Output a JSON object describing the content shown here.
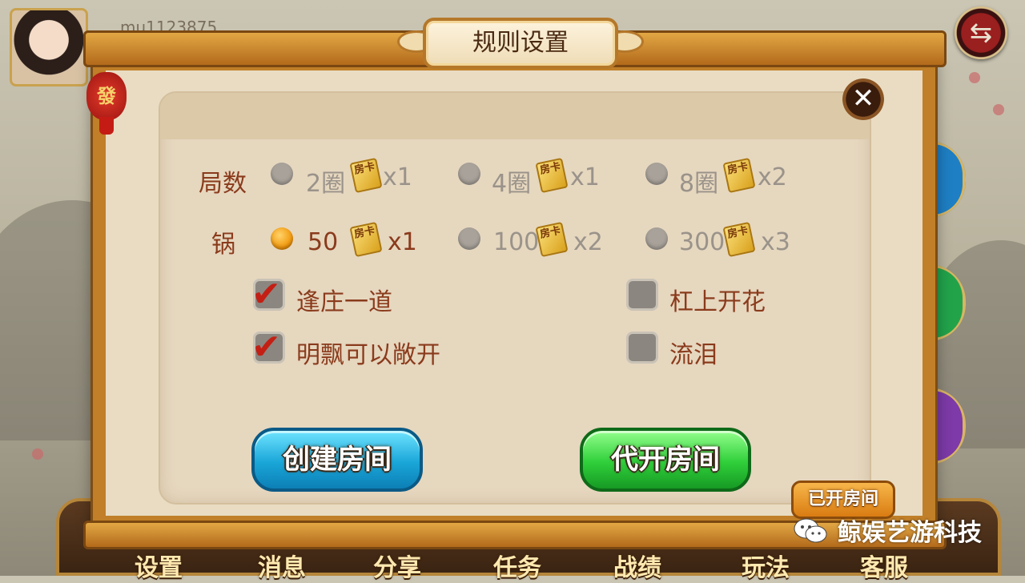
{
  "player": {
    "id": "mu1123875"
  },
  "dialog": {
    "title": "规则设置",
    "lantern_char": "發",
    "close_symbol": "✕"
  },
  "rules": {
    "rounds": {
      "label": "局数",
      "options": [
        {
          "text": "2圈",
          "multiplier": "x1",
          "selected": false
        },
        {
          "text": "4圈",
          "multiplier": "x1",
          "selected": false
        },
        {
          "text": "8圈",
          "multiplier": "x2",
          "selected": false
        }
      ]
    },
    "pot": {
      "label": "锅",
      "options": [
        {
          "text": "50",
          "multiplier": "x1",
          "selected": true
        },
        {
          "text": "100",
          "multiplier": "x2",
          "selected": false
        },
        {
          "text": "300",
          "multiplier": "x3",
          "selected": false
        }
      ]
    },
    "card_label": "房卡",
    "toggles": [
      {
        "text": "逢庄一道",
        "checked": true
      },
      {
        "text": "杠上开花",
        "checked": false
      },
      {
        "text": "明飘可以敞开",
        "checked": true
      },
      {
        "text": "流泪",
        "checked": false
      }
    ]
  },
  "buttons": {
    "create_room": "创建房间",
    "proxy_room": "代开房间",
    "opened_rooms": "已开房间"
  },
  "bottom_menu": [
    "设置",
    "消息",
    "分享",
    "任务",
    "战绩",
    "玩法",
    "客服"
  ],
  "watermark": "鲸娱艺游科技",
  "colors": {
    "accent": "#c07f28",
    "selected_radio": "#f29b10",
    "check": "#c41f14",
    "label": "#8a3b1c"
  }
}
